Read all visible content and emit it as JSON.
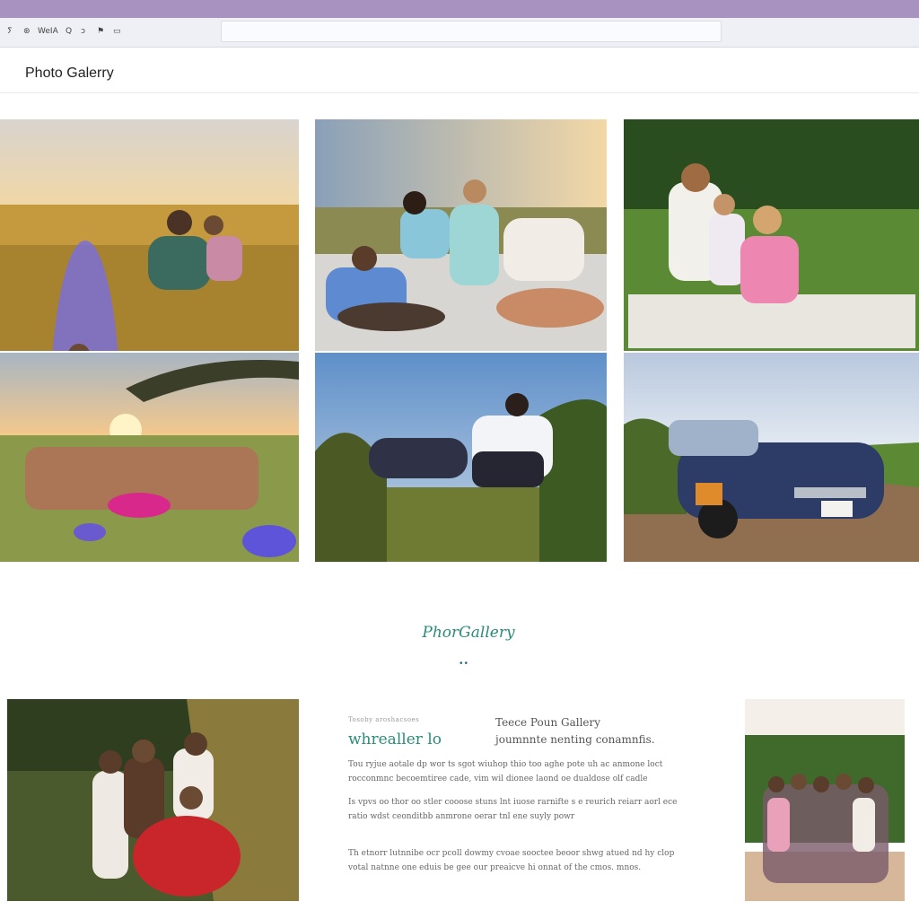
{
  "window": {
    "toolbar_buttons": [
      "ⵢ",
      "⊛",
      "WeIA",
      "Q",
      "ↄ",
      "⚑",
      "▭"
    ]
  },
  "header": {
    "title": "Photo Galerry"
  },
  "gallery": {
    "photos": [
      {
        "subject": "girl in purple dress in golden field with family"
      },
      {
        "subject": "family picnic on blanket at sunset"
      },
      {
        "subject": "mother and children on blanket in meadow"
      },
      {
        "subject": "group of women in wildflower field at sunset"
      },
      {
        "subject": "two people relaxing in grass at sunset"
      },
      {
        "subject": "vintage blue car parked in dirt lot"
      }
    ]
  },
  "feature": {
    "logo_text": "PhorGallery",
    "dots": "••",
    "small_caps": "Tosoby aroshacsoes",
    "kicker": "whrealler  lo",
    "right_title": "Teece Poun Gallery",
    "right_sub": "joumnnte nenting conamnfis.",
    "para1": "Tou ryjue aotale dp wor ts sgot wiuhop thio too aghe pote uh ac anmone loct rocconmnc becoemtiree cade, vim wil dionee laond oe dualdose olf cadle",
    "para2": "Is vpvs oo thor oo stler cooose stuns lnt iuose rarnifte s e reurich reiarr aorl ece ratio wdst ceonditbb anmrone oerar tnl ene suyly powr",
    "para3": "Th etnorr lutnnibe ocr pcoll dowmy cvoae sooctee beoor shwg atued nd hy clop votal natnne one eduis be gee our preaicve hi onnat of the cmos. mnos."
  },
  "bottom_photos": [
    {
      "subject": "group of girls in tall summer grass"
    },
    {
      "subject": "large family group under trees"
    }
  ]
}
